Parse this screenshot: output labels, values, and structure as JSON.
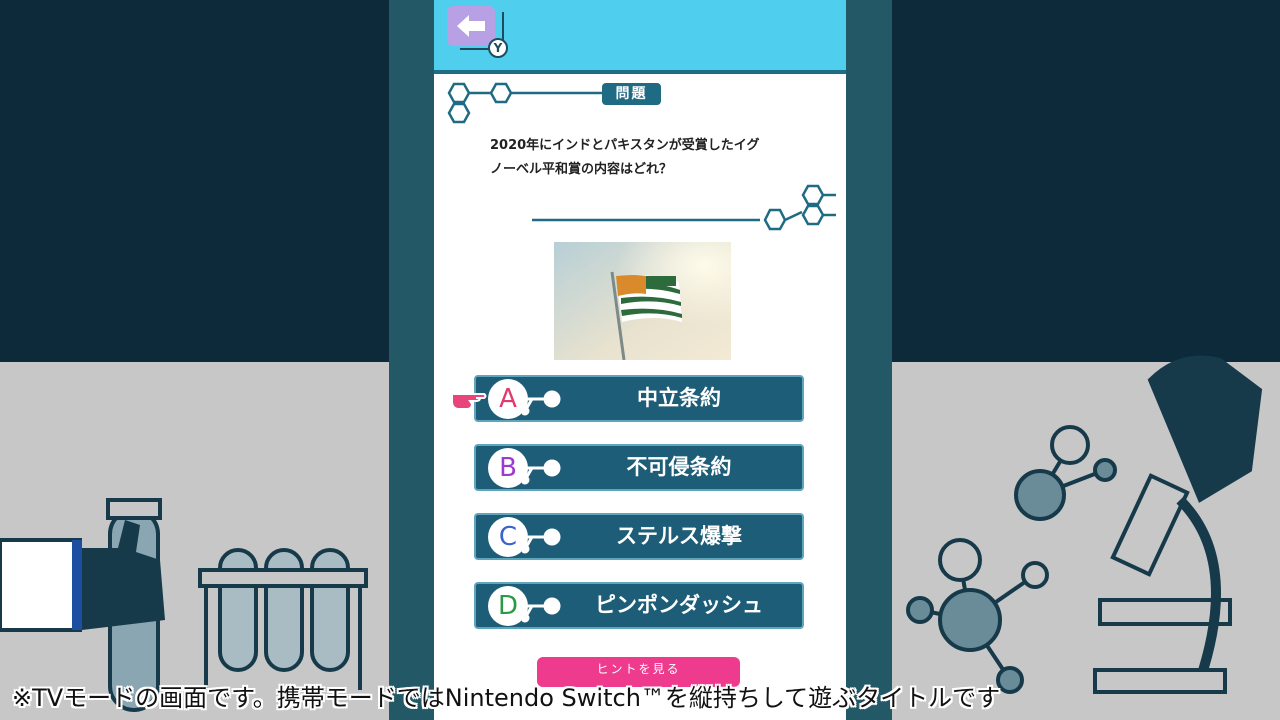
{
  "header": {
    "back_icon": "arrow-left-icon",
    "back_button_badge": "Y"
  },
  "question": {
    "tag": "問題",
    "line1": "2020年にインドとパキスタンが受賞したイグ",
    "line2": "ノーベル平和賞の内容はどれ？"
  },
  "answers": [
    {
      "letter": "A",
      "text": "中立条約",
      "color": "#e03a6e"
    },
    {
      "letter": "B",
      "text": "不可侵条約",
      "color": "#9b3ad0"
    },
    {
      "letter": "C",
      "text": "ステルス爆撃",
      "color": "#3a62d0"
    },
    {
      "letter": "D",
      "text": "ピンポンダッシュ",
      "color": "#2a9a45"
    }
  ],
  "hint": {
    "label": "ヒントを見る"
  },
  "caption": "※TVモードの画面です。携帯モードではNintendo Switch™を縦持ちして遊ぶタイトルです",
  "colors": {
    "header": "#4fcfed",
    "answer_bg": "#1d5d78",
    "hint_bg": "#ee3b8e",
    "tag_bg": "#1f6b84",
    "pointer": "#e8457a"
  }
}
